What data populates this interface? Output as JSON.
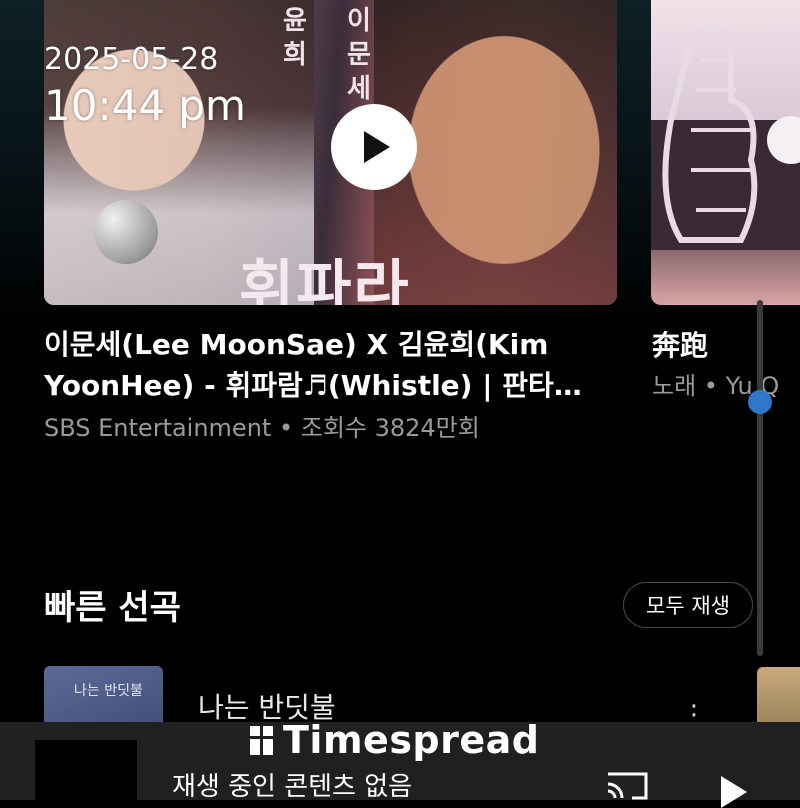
{
  "featured_video": {
    "thumbnail_text": {
      "vertical_1": [
        "윤",
        "희"
      ],
      "vertical_2": [
        "이",
        "문",
        "세"
      ],
      "big": "휘파라"
    },
    "timestamp_date": "2025-05-28",
    "timestamp_time": "10:44 pm",
    "title": "이문세(Lee MoonSae) X 김윤희(Kim YoonHee) - 휘파람♬(Whistle) | 판타…",
    "meta": "SBS Entertainment • 조회수 3824만회"
  },
  "second_card": {
    "title": "奔跑",
    "meta": "노래 • Yu Q"
  },
  "quick_picks": {
    "title": "빠른 선곡",
    "play_all_label": "모두 재생",
    "items": [
      {
        "title": "나는 반딧불",
        "thumb_text": "나는 반딧불"
      }
    ]
  },
  "mini_player": {
    "title": "재생 중인 콘텐츠 없음"
  },
  "watermark": {
    "text": "Timespread"
  },
  "colors": {
    "accent": "#2f77c9",
    "background": "#000000",
    "miniplayer": "#202020"
  }
}
